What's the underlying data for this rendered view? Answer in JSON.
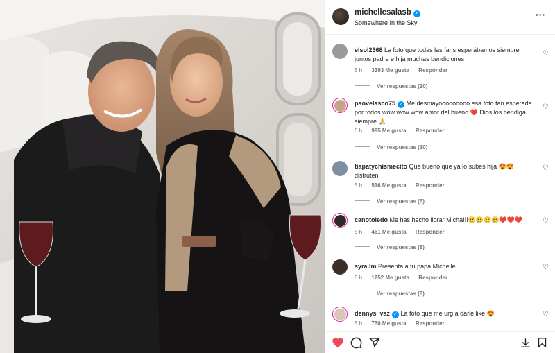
{
  "post": {
    "username": "michellesalasb",
    "location": "Somewhere In the Sky",
    "more_icon": "ellipsis-icon"
  },
  "comments": [
    {
      "user": "elsol2368",
      "text": "La foto que todas las fans esperábamos siempre juntos padre e hija muchas bendiciones",
      "time": "5 h",
      "likes": "3393 Me gusta",
      "reply": "Responder",
      "replies": "Ver respuestas (20)",
      "avatar_color": "#8a8a8a",
      "story": false,
      "verified": false
    },
    {
      "user": "paovelasco75",
      "text": "Me desmayooooooooo esa foto tan esperada por todos wow wow wow amor del bueno ❤️ Dios los bendiga siempre 🙏",
      "time": "6 h",
      "likes": "995 Me gusta",
      "reply": "Responder",
      "replies": "Ver respuestas (10)",
      "avatar_color": "#c7a489",
      "story": true,
      "verified": true
    },
    {
      "user": "tiapatychismecito",
      "text": "Que bueno que ya lo subes hija 😍😍 disfruten",
      "time": "5 h",
      "likes": "516 Me gusta",
      "reply": "Responder",
      "replies": "Ver respuestas (6)",
      "avatar_color": "#7e8fa1",
      "story": false,
      "verified": false
    },
    {
      "user": "canotoledo",
      "text": "Me has hecho llorar Micha!!!😢😢😢😢❤️❤️❤️",
      "time": "5 h",
      "likes": "461 Me gusta",
      "reply": "Responder",
      "replies": "Ver respuestas (8)",
      "avatar_color": "#2f2a27",
      "story": true,
      "verified": false
    },
    {
      "user": "syra.lm",
      "text": "Presenta a tu papá Michelle",
      "time": "5 h",
      "likes": "1252 Me gusta",
      "reply": "Responder",
      "replies": "Ver respuestas (8)",
      "avatar_color": "#3b2f2a",
      "story": false,
      "verified": false
    },
    {
      "user": "dennys_vaz",
      "text": "La foto que me urgía darle like 😍",
      "time": "5 h",
      "likes": "760 Me gusta",
      "reply": "Responder",
      "replies": "",
      "avatar_color": "#d9c7b5",
      "story": true,
      "verified": true
    }
  ],
  "actions": {
    "like_icon": "heart-filled-icon",
    "comment_icon": "comment-icon",
    "share_icon": "share-icon",
    "save_icon": "bookmark-icon",
    "download_icon": "download-icon",
    "like_color": "#ed4956"
  }
}
